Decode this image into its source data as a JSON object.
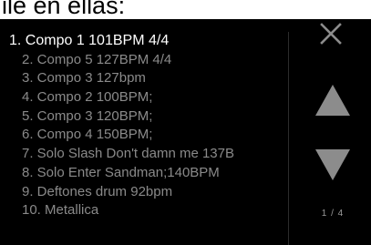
{
  "caption": "ile en ellas:",
  "songs": [
    "1. Compo 1 101BPM 4/4",
    "2. Compo 5 127BPM 4/4",
    "3. Compo 3 127bpm",
    "4. Compo 2 100BPM;",
    "5. Compo 3 120BPM;",
    "6. Compo 4 150BPM;",
    "7. Solo Slash Don't damn me 137B",
    "8. Solo Enter Sandman;140BPM",
    "9. Deftones drum 92bpm",
    "10. Metallica"
  ],
  "selected_index": 0,
  "pager": {
    "indicator": "1 / 4"
  },
  "icons": {
    "close": "close-icon",
    "up": "triangle-up-icon",
    "down": "triangle-down-icon"
  },
  "colors": {
    "background": "#000000",
    "selected_text": "#ffffff",
    "item_text": "#8a8a8a",
    "icon": "#8c8c8c"
  }
}
